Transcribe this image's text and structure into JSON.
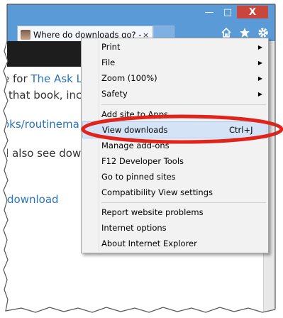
{
  "window": {
    "buttons": {
      "minimize": "—",
      "maximize": "□",
      "close": "X"
    }
  },
  "tab": {
    "title": "Where do downloads go? -…",
    "close": "×"
  },
  "page": {
    "lines": [
      {
        "prefix": "e for ",
        "link": "The Ask Le"
      },
      {
        "text": "that book, incl"
      },
      {
        "link": "oks/routinema"
      },
      {
        "text": "ll also see dow"
      },
      {
        "link": "download"
      }
    ]
  },
  "menu": {
    "items": [
      {
        "label": "Print",
        "submenu": true
      },
      {
        "label": "File",
        "submenu": true
      },
      {
        "label": "Zoom (100%)",
        "submenu": true
      },
      {
        "label": "Safety",
        "submenu": true
      },
      {
        "label": "Add site to Apps"
      },
      {
        "label": "View downloads",
        "shortcut": "Ctrl+J"
      },
      {
        "label": "Manage add-ons"
      },
      {
        "label": "F12 Developer Tools"
      },
      {
        "label": "Go to pinned sites"
      },
      {
        "label": "Compatibility View settings"
      },
      {
        "label": "Report website problems"
      },
      {
        "label": "Internet options"
      },
      {
        "label": "About Internet Explorer"
      }
    ]
  },
  "colors": {
    "chrome": "#5a9ad6",
    "close_button": "#c9463d",
    "highlight_ring": "#e2231a",
    "selected": "#d4e4f6",
    "link": "#2a74b8"
  }
}
